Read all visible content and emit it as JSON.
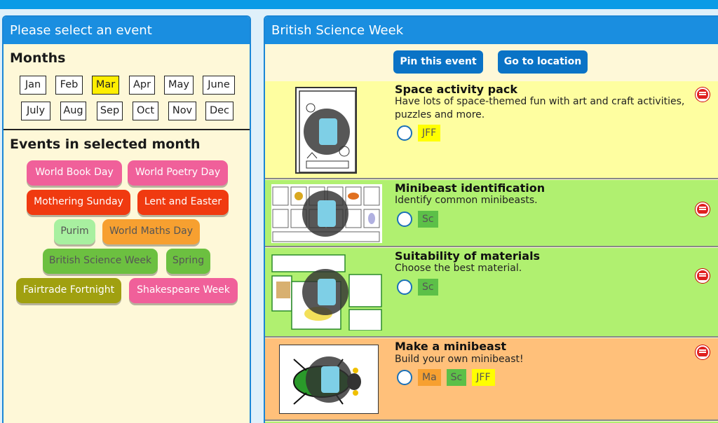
{
  "left": {
    "header": "Please select an event",
    "months_title": "Months",
    "months": [
      "Jan",
      "Feb",
      "Mar",
      "Apr",
      "May",
      "June",
      "July",
      "Aug",
      "Sep",
      "Oct",
      "Nov",
      "Dec"
    ],
    "selected_month": "Mar",
    "events_title": "Events in selected month",
    "events": [
      {
        "label": "World Book Day",
        "color": "#f0609a"
      },
      {
        "label": "World Poetry Day",
        "color": "#f0609a"
      },
      {
        "label": "Mothering Sunday",
        "color": "#f03a10"
      },
      {
        "label": "Lent and Easter",
        "color": "#f03a10"
      },
      {
        "label": "Purim",
        "color": "#a8f0a0"
      },
      {
        "label": "World Maths Day",
        "color": "#f7a030"
      },
      {
        "label": "British Science Week",
        "color": "#6cc040"
      },
      {
        "label": "Spring",
        "color": "#6cc040"
      },
      {
        "label": "Fairtrade Fortnight",
        "color": "#a0a010"
      },
      {
        "label": "Shakespeare Week",
        "color": "#f0609a"
      }
    ]
  },
  "right": {
    "header": "British Science Week",
    "pin_button": "Pin this event",
    "location_button": "Go to location",
    "activities": [
      {
        "title": "Space activity pack",
        "description": "Have lots of space-themed fun with art and craft activities, puzzles and more.",
        "background": "#fefea0",
        "icon": "space-icon",
        "tags": [
          {
            "label": "JFF",
            "color": "#ffff00"
          }
        ]
      },
      {
        "title": "Minibeast identification",
        "description": "Identify common minibeasts.",
        "background": "#b0f070",
        "icon": "label-icon",
        "tags": [
          {
            "label": "Sc",
            "color": "#5cc048"
          }
        ]
      },
      {
        "title": "Suitability of materials",
        "description": "Choose the best material.",
        "background": "#b0f070",
        "icon": "materials-icon",
        "tags": [
          {
            "label": "Sc",
            "color": "#5cc048"
          }
        ]
      },
      {
        "title": "Make a minibeast",
        "description": "Build your own minibeast!",
        "background": "#ffc07a",
        "icon": "minibeast-icon",
        "tags": [
          {
            "label": "Ma",
            "color": "#f7a030"
          },
          {
            "label": "Sc",
            "color": "#5cc048"
          },
          {
            "label": "JFF",
            "color": "#ffff00"
          }
        ]
      }
    ]
  },
  "colors": {
    "header_blue": "#1a8ee0",
    "button_blue": "#0a73c6",
    "selected_month": "#ffee00",
    "panel_bg": "#fef8d8"
  }
}
